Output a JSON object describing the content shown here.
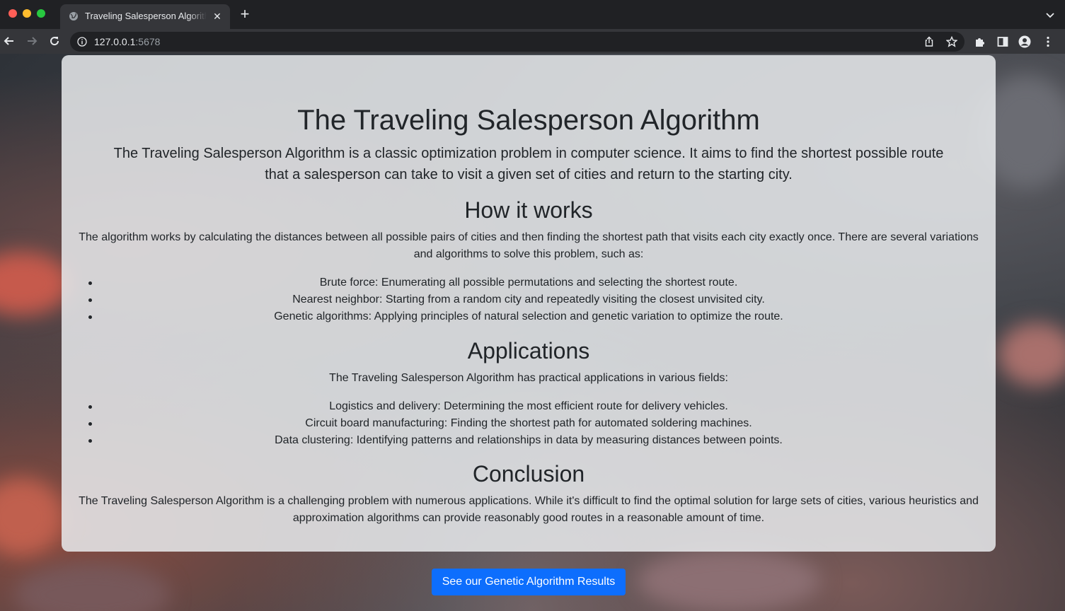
{
  "browser": {
    "tab_title": "Traveling Salesperson Algorithm",
    "tab_close": "✕",
    "new_tab": "+",
    "url_host": "127.0.0.1",
    "url_port": ":5678"
  },
  "page": {
    "title": "The Traveling Salesperson Algorithm",
    "intro": "The Traveling Salesperson Algorithm is a classic optimization problem in computer science. It aims to find the shortest possible route that a salesperson can take to visit a given set of cities and return to the starting city.",
    "how": {
      "heading": "How it works",
      "text": "The algorithm works by calculating the distances between all possible pairs of cities and then finding the shortest path that visits each city exactly once. There are several variations and algorithms to solve this problem, such as:",
      "items": [
        "Brute force: Enumerating all possible permutations and selecting the shortest route.",
        "Nearest neighbor: Starting from a random city and repeatedly visiting the closest unvisited city.",
        "Genetic algorithms: Applying principles of natural selection and genetic variation to optimize the route."
      ]
    },
    "applications": {
      "heading": "Applications",
      "text": "The Traveling Salesperson Algorithm has practical applications in various fields:",
      "items": [
        "Logistics and delivery: Determining the most efficient route for delivery vehicles.",
        "Circuit board manufacturing: Finding the shortest path for automated soldering machines.",
        "Data clustering: Identifying patterns and relationships in data by measuring distances between points."
      ]
    },
    "conclusion": {
      "heading": "Conclusion",
      "text": "The Traveling Salesperson Algorithm is a challenging problem with numerous applications. While it's difficult to find the optimal solution for large sets of cities, various heuristics and approximation algorithms can provide reasonably good routes in a reasonable amount of time."
    },
    "cta_label": "See our Genetic Algorithm Results"
  },
  "colors": {
    "accent": "#0d6efd",
    "card": "#e8eaec",
    "text": "#212529"
  }
}
